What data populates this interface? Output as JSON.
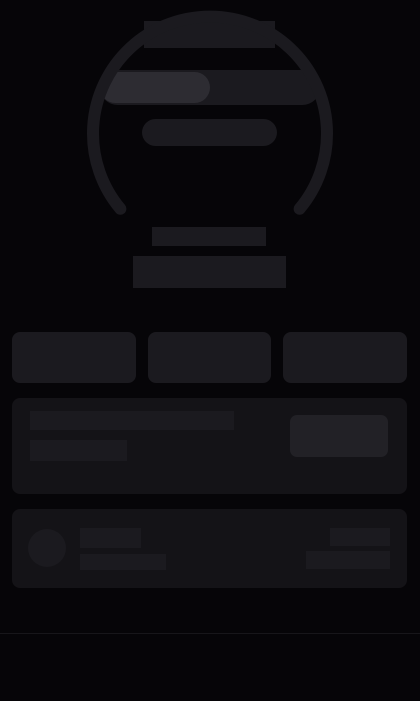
{
  "theme": {
    "background": "#060508",
    "skeleton": "#1b1a1f",
    "skeleton_highlight": "#2d2c32",
    "card": "#141317",
    "gauge_track": "#1b1a1f"
  },
  "state": "loading-skeleton",
  "toggle": {
    "highlighted_fraction": 0.5
  },
  "gauge": {
    "sweep_degrees": 260
  }
}
